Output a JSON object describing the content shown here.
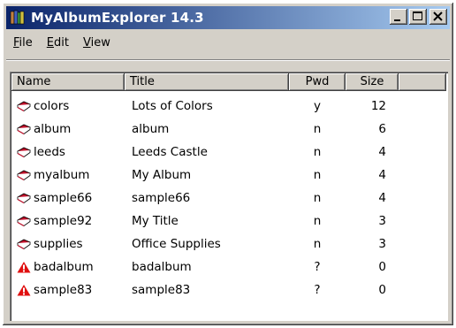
{
  "window": {
    "title": "MyAlbumExplorer 14.3"
  },
  "menu": [
    {
      "label": "File",
      "ul": "F",
      "rest": "ile"
    },
    {
      "label": "Edit",
      "ul": "E",
      "rest": "dit"
    },
    {
      "label": "View",
      "ul": "V",
      "rest": "iew"
    }
  ],
  "columns": [
    "Name",
    "Title",
    "Pwd",
    "Size"
  ],
  "rows": [
    {
      "name": "colors",
      "title": "Lots of Colors",
      "pwd": "y",
      "size": "12",
      "icon": "book-icon"
    },
    {
      "name": "album",
      "title": "album",
      "pwd": "n",
      "size": "6",
      "icon": "book-icon"
    },
    {
      "name": "leeds",
      "title": "Leeds Castle",
      "pwd": "n",
      "size": "4",
      "icon": "book-icon"
    },
    {
      "name": "myalbum",
      "title": "My Album",
      "pwd": "n",
      "size": "4",
      "icon": "book-icon"
    },
    {
      "name": "sample66",
      "title": "sample66",
      "pwd": "n",
      "size": "4",
      "icon": "book-icon"
    },
    {
      "name": "sample92",
      "title": "My Title",
      "pwd": "n",
      "size": "3",
      "icon": "book-icon"
    },
    {
      "name": "supplies",
      "title": "Office Supplies",
      "pwd": "n",
      "size": "3",
      "icon": "book-icon"
    },
    {
      "name": "badalbum",
      "title": "badalbum",
      "pwd": "?",
      "size": "0",
      "icon": "warning-icon"
    },
    {
      "name": "sample83",
      "title": "sample83",
      "pwd": "?",
      "size": "0",
      "icon": "warning-icon"
    }
  ],
  "colors": {
    "titlebar_start": "#0a246a",
    "titlebar_end": "#a6caf0",
    "book": "#c0102a",
    "warning": "#e01010"
  }
}
